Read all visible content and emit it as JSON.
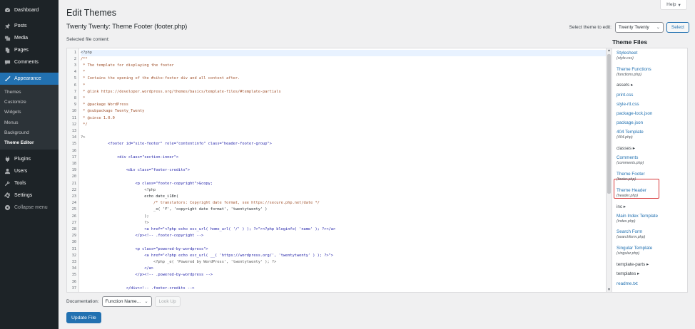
{
  "sidebar": {
    "items": [
      {
        "label": "Dashboard",
        "icon": "dashboard-icon"
      },
      {
        "label": "Posts",
        "icon": "pin-icon"
      },
      {
        "label": "Media",
        "icon": "media-icon"
      },
      {
        "label": "Pages",
        "icon": "pages-icon"
      },
      {
        "label": "Comments",
        "icon": "comments-icon"
      },
      {
        "label": "Appearance",
        "icon": "brush-icon",
        "active": true
      },
      {
        "label": "Plugins",
        "icon": "plugin-icon"
      },
      {
        "label": "Users",
        "icon": "users-icon"
      },
      {
        "label": "Tools",
        "icon": "wrench-icon"
      },
      {
        "label": "Settings",
        "icon": "settings-icon"
      }
    ],
    "submenu": [
      "Themes",
      "Customize",
      "Widgets",
      "Menus",
      "Background",
      "Theme Editor"
    ],
    "collapse_label": "Collapse menu"
  },
  "header": {
    "help_label": "Help",
    "title": "Edit Themes",
    "file_heading": "Twenty Twenty: Theme Footer (footer.php)",
    "selected_label": "Selected file content:",
    "select_theme_label": "Select theme to edit:",
    "select_theme_value": "Twenty Twenty",
    "select_button": "Select"
  },
  "editor": {
    "lines": [
      "<?php",
      "/**",
      " * The template for displaying the footer",
      " *",
      " * Contains the opening of the #site-footer div and all content after.",
      " *",
      " * @link https://developer.wordpress.org/themes/basics/template-files/#template-partials",
      " *",
      " * @package WordPress",
      " * @subpackage Twenty_Twenty",
      " * @since 1.0.0",
      " */",
      "",
      "?>",
      "            <footer id=\"site-footer\" role=\"contentinfo\" class=\"header-footer-group\">",
      "",
      "                <div class=\"section-inner\">",
      "",
      "                    <div class=\"footer-credits\">",
      "",
      "                        <p class=\"footer-copyright\">&copy;",
      "                            <?php",
      "                            echo date_i18n(",
      "                                /* translators: Copyright date format, see https://secure.php.net/date */",
      "                                _x( 'Y', 'copyright date format', 'twentytwenty' )",
      "                            );",
      "                            ?>",
      "                            <a href=\"<?php echo esc_url( home_url( '/' ) ); ?>\"><?php bloginfo( 'name' ); ?></a>",
      "                        </p><!-- .footer-copyright -->",
      "",
      "                        <p class=\"powered-by-wordpress\">",
      "                            <a href=\"<?php echo esc_url( __( 'https://wordpress.org/', 'twentytwenty' ) ); ?>\">",
      "                                <?php _e( 'Powered by WordPress', 'twentytwenty' ); ?>",
      "                            </a>",
      "                        </p><!-- .powered-by-wordpress -->",
      "",
      "                    </div><!-- .footer-credits -->"
    ]
  },
  "files": {
    "title": "Theme Files",
    "items": [
      {
        "name": "Stylesheet",
        "sub": "(style.css)"
      },
      {
        "name": "Theme Functions",
        "sub": "(functions.php)"
      },
      {
        "name": "assets ▸",
        "dir": true
      },
      {
        "name": "print.css"
      },
      {
        "name": "style-rtl.css"
      },
      {
        "name": "package-lock.json"
      },
      {
        "name": "package.json"
      },
      {
        "name": "404 Template",
        "sub": "(404.php)"
      },
      {
        "name": "classes ▸",
        "dir": true
      },
      {
        "name": "Comments",
        "sub": "(comments.php)"
      },
      {
        "name": "Theme Footer",
        "sub": "(footer.php)",
        "current": true
      },
      {
        "name": "Theme Header",
        "sub": "(header.php)"
      },
      {
        "name": "inc ▸",
        "dir": true
      },
      {
        "name": "Main Index Template",
        "sub": "(index.php)"
      },
      {
        "name": "Search Form",
        "sub": "(searchform.php)"
      },
      {
        "name": "Singular Template",
        "sub": "(singular.php)"
      },
      {
        "name": "template-parts ▸",
        "dir": true
      },
      {
        "name": "templates ▸",
        "dir": true
      },
      {
        "name": "readme.txt"
      }
    ]
  },
  "bottom": {
    "doc_label": "Documentation:",
    "doc_select": "Function Name...",
    "lookup_button": "Look Up",
    "update_button": "Update File"
  }
}
